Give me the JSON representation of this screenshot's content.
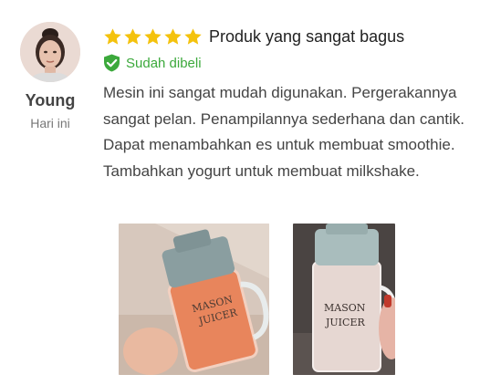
{
  "review": {
    "author": {
      "name": "Young",
      "date": "Hari ini",
      "avatar_icon": "user-avatar-photo"
    },
    "rating": 5,
    "rating_max": 5,
    "star_color": "#f4c20d",
    "title": "Produk yang sangat bagus",
    "verified": {
      "label": "Sudah dibeli",
      "icon": "shield-check-icon",
      "color": "#3ca93c"
    },
    "body": "Mesin ini sangat mudah digunakan. Pergerakannya sangat pelan. Penampilannya sederhana dan cantik. Dapat menambahkan es untuk membuat smoothie. Tambahkan yogurt untuk membuat milkshake.",
    "photos": [
      {
        "name": "review-photo-1",
        "label": "MASON JUICER"
      },
      {
        "name": "review-photo-2",
        "label": "MASON JUICER"
      }
    ]
  }
}
